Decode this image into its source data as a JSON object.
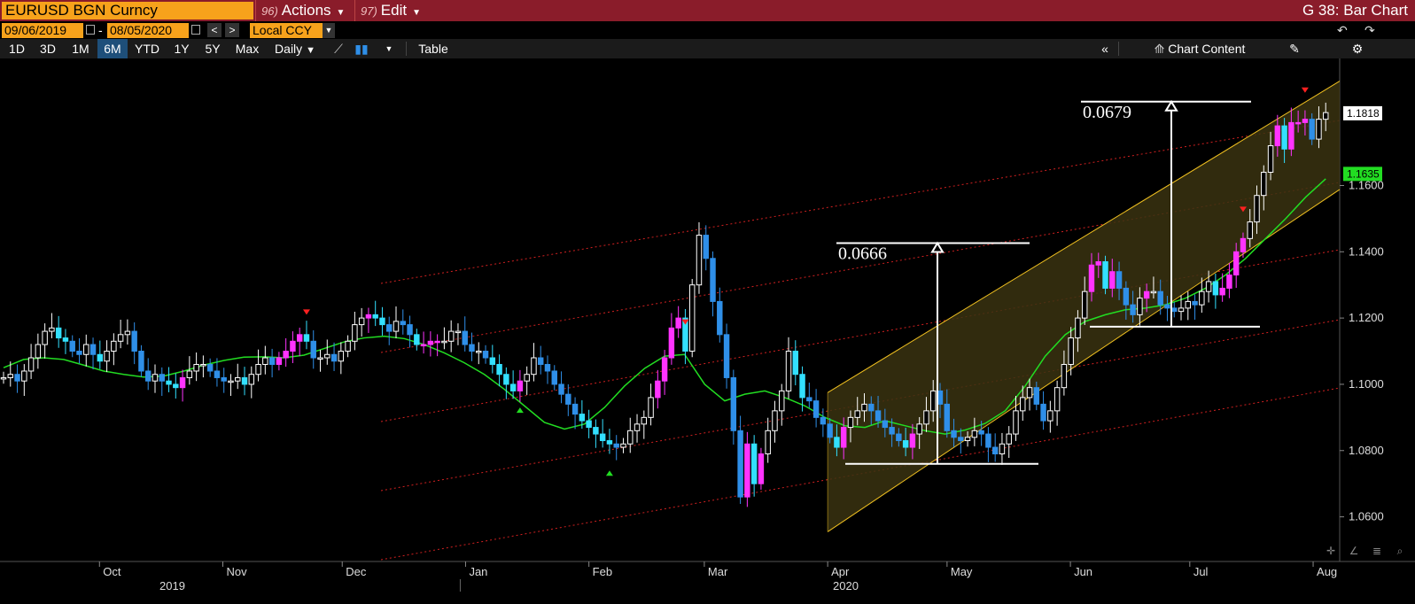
{
  "header": {
    "ticker": "EURUSD BGN Curncy",
    "actions_num": "96)",
    "actions_label": "Actions",
    "edit_num": "97)",
    "edit_label": "Edit",
    "chart_title": "G 38: Bar Chart"
  },
  "daterow": {
    "start_date": "09/06/2019",
    "end_date": "08/05/2020",
    "currency": "Local CCY"
  },
  "toolbar": {
    "periods": [
      "1D",
      "3D",
      "1M",
      "6M",
      "YTD",
      "1Y",
      "5Y",
      "Max"
    ],
    "active_period": "6M",
    "frequency": "Daily",
    "table_label": "Table",
    "chart_content_label": "Chart Content"
  },
  "colors": {
    "title_bar": "#8a1c2a",
    "input_bg": "#f7a21b",
    "up_candle": "#ffffff",
    "down_candle": "#2f8fe8",
    "td_up": "#ff33ff",
    "td_down": "#33e0ff",
    "moving_average": "#22dd22",
    "channel": "#f0c020",
    "channel_fill": "#3a3210",
    "trend_lines": "#d02020",
    "signal_sell": "#ff2020",
    "signal_buy": "#22dd22"
  },
  "chart_data": {
    "type": "candlestick",
    "instrument": "EURUSD",
    "frequency": "Daily",
    "date_range": [
      "2019-09-06",
      "2020-08-05"
    ],
    "ylim": [
      1.05,
      1.193
    ],
    "y_ticks": [
      1.06,
      1.08,
      1.1,
      1.12,
      1.14,
      1.16
    ],
    "y_tick_labels": [
      "1.0600",
      "1.0800",
      "1.1000",
      "1.1200",
      "1.1400",
      "1.1600"
    ],
    "last_price": "1.1818",
    "moving_average_value": "1.1635",
    "x_months": [
      "Oct",
      "Nov",
      "Dec",
      "Jan",
      "Feb",
      "Mar",
      "Apr",
      "May",
      "Jun",
      "Jul",
      "Aug"
    ],
    "x_years": [
      "2019",
      "2020"
    ],
    "closes": [
      1.102,
      1.103,
      1.101,
      1.104,
      1.108,
      1.112,
      1.116,
      1.117,
      1.114,
      1.113,
      1.11,
      1.109,
      1.112,
      1.109,
      1.107,
      1.11,
      1.113,
      1.115,
      1.116,
      1.11,
      1.104,
      1.101,
      1.103,
      1.101,
      1.1,
      1.099,
      1.102,
      1.104,
      1.106,
      1.106,
      1.104,
      1.102,
      1.101,
      1.101,
      1.102,
      1.1,
      1.103,
      1.106,
      1.108,
      1.106,
      1.108,
      1.11,
      1.113,
      1.115,
      1.113,
      1.108,
      1.108,
      1.109,
      1.107,
      1.11,
      1.113,
      1.118,
      1.12,
      1.121,
      1.12,
      1.118,
      1.116,
      1.119,
      1.118,
      1.115,
      1.112,
      1.112,
      1.113,
      1.113,
      1.113,
      1.116,
      1.116,
      1.112,
      1.11,
      1.11,
      1.108,
      1.106,
      1.103,
      1.1,
      1.098,
      1.101,
      1.103,
      1.108,
      1.106,
      1.104,
      1.1,
      1.097,
      1.094,
      1.091,
      1.089,
      1.087,
      1.085,
      1.083,
      1.082,
      1.081,
      1.082,
      1.086,
      1.088,
      1.09,
      1.096,
      1.101,
      1.108,
      1.117,
      1.12,
      1.11,
      1.13,
      1.145,
      1.138,
      1.125,
      1.115,
      1.102,
      1.086,
      1.066,
      1.082,
      1.07,
      1.079,
      1.086,
      1.092,
      1.098,
      1.11,
      1.103,
      1.096,
      1.095,
      1.09,
      1.088,
      1.084,
      1.081,
      1.087,
      1.09,
      1.092,
      1.094,
      1.092,
      1.089,
      1.087,
      1.085,
      1.083,
      1.081,
      1.085,
      1.088,
      1.092,
      1.098,
      1.094,
      1.086,
      1.084,
      1.083,
      1.084,
      1.086,
      1.085,
      1.081,
      1.079,
      1.082,
      1.085,
      1.092,
      1.096,
      1.099,
      1.094,
      1.089,
      1.092,
      1.099,
      1.106,
      1.114,
      1.12,
      1.128,
      1.136,
      1.137,
      1.129,
      1.134,
      1.129,
      1.124,
      1.121,
      1.126,
      1.128,
      1.128,
      1.124,
      1.123,
      1.122,
      1.123,
      1.125,
      1.124,
      1.128,
      1.131,
      1.127,
      1.129,
      1.133,
      1.14,
      1.144,
      1.149,
      1.157,
      1.164,
      1.172,
      1.178,
      1.171,
      1.179,
      1.179,
      1.18,
      1.174,
      1.18,
      1.182
    ],
    "moving_average": [
      1.105,
      1.1075,
      1.108,
      1.1075,
      1.1058,
      1.104,
      1.103,
      1.1022,
      1.1025,
      1.104,
      1.1058,
      1.1072,
      1.1082,
      1.1083,
      1.108,
      1.1088,
      1.1108,
      1.1128,
      1.114,
      1.1145,
      1.1138,
      1.112,
      1.1095,
      1.1065,
      1.103,
      1.0985,
      1.0935,
      1.0885,
      1.0865,
      1.088,
      1.093,
      1.0995,
      1.1048,
      1.1085,
      1.109,
      1.1,
      1.095,
      1.097,
      1.098,
      1.096,
      1.0935,
      1.09,
      1.0875,
      1.087,
      1.089,
      1.0875,
      1.086,
      1.085,
      1.0862,
      1.0882,
      1.092,
      1.0995,
      1.1085,
      1.115,
      1.119,
      1.121,
      1.1225,
      1.123,
      1.124,
      1.126,
      1.129,
      1.133,
      1.138,
      1.144,
      1.15,
      1.1565,
      1.162
    ],
    "channel": {
      "lower": [
        [
          1.0555,
          "2020-04-01"
        ],
        [
          1.1588,
          "2020-08-05"
        ]
      ],
      "upper": [
        [
          1.0975,
          "2020-04-01"
        ],
        [
          1.1915,
          "2020-08-05"
        ]
      ]
    },
    "annotations": [
      {
        "label": "0.0666",
        "from": 1.076,
        "to": 1.1426
      },
      {
        "label": "0.0679",
        "from": 1.1174,
        "to": 1.1853
      }
    ]
  }
}
